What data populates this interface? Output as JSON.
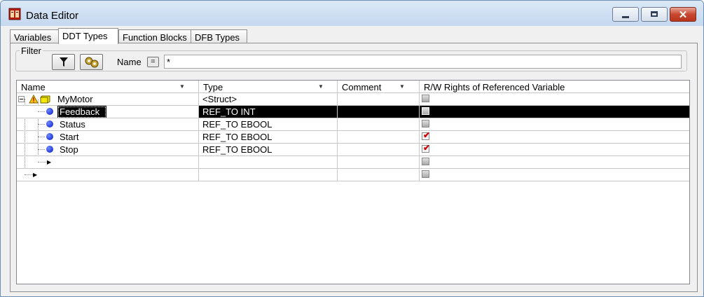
{
  "window": {
    "title": "Data Editor"
  },
  "tabs": [
    {
      "label": "Variables",
      "active": false
    },
    {
      "label": "DDT Types",
      "active": true
    },
    {
      "label": "Function Blocks",
      "active": false
    },
    {
      "label": "DFB Types",
      "active": false
    }
  ],
  "filter": {
    "legend": "Filter",
    "name_label": "Name",
    "eq_label": "=",
    "name_value": "*"
  },
  "grid": {
    "columns": [
      "Name",
      "Type",
      "Comment",
      "R/W Rights of Referenced Variable"
    ],
    "rows": [
      {
        "name": "MyMotor",
        "type": "<Struct>",
        "comment": "",
        "rw_checked": false,
        "level": 0
      },
      {
        "name": "Feedback",
        "type": "REF_TO INT",
        "comment": "",
        "rw_checked": false,
        "level": 1,
        "selected": true
      },
      {
        "name": "Status",
        "type": "REF_TO EBOOL",
        "comment": "",
        "rw_checked": false,
        "level": 1
      },
      {
        "name": "Start",
        "type": "REF_TO EBOOL",
        "comment": "",
        "rw_checked": true,
        "level": 1
      },
      {
        "name": "Stop",
        "type": "REF_TO EBOOL",
        "comment": "",
        "rw_checked": true,
        "level": 1
      },
      {
        "name": "",
        "type": "",
        "comment": "",
        "rw_checked": false,
        "level": 1,
        "placeholder": true
      },
      {
        "name": "",
        "type": "",
        "comment": "",
        "rw_checked": false,
        "level": 0,
        "placeholder": true
      }
    ]
  },
  "colors": {
    "selection": "#000000",
    "check": "#cc0000",
    "dot": "#0012c8"
  },
  "icons": {
    "app": "data-editor-app-icon",
    "filter_button": "funnel-icon",
    "generate_button": "gears-icon",
    "struct": "struct-warning-icon",
    "element": "blue-dot-icon"
  }
}
